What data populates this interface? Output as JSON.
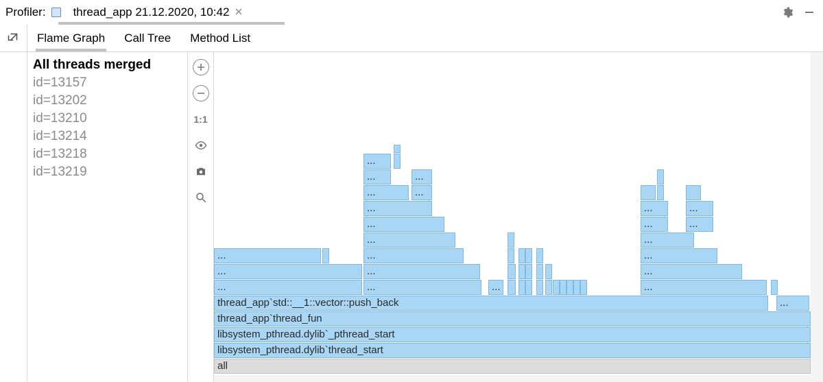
{
  "topbar": {
    "label": "Profiler:",
    "session_name": "thread_app 21.12.2020, 10:42"
  },
  "view_tabs": [
    "Flame Graph",
    "Call Tree",
    "Method List"
  ],
  "active_view_tab": 0,
  "threads_header": "All threads merged",
  "threads": [
    "id=13157",
    "id=13202",
    "id=13210",
    "id=13214",
    "id=13218",
    "id=13219"
  ],
  "tools": {
    "one_to_one": "1:1"
  },
  "flame": {
    "base_label": "all",
    "stack_labels": [
      "libsystem_pthread.dylib`thread_start",
      "libsystem_pthread.dylib`_pthread_start",
      "thread_app`thread_fun",
      "thread_app`std::__1::vector::push_back"
    ],
    "ellipsis": "..."
  },
  "colors": {
    "frame_bg": "#a9d6f5",
    "frame_border": "#7fb9df",
    "base_bg": "#dcdcdc"
  }
}
